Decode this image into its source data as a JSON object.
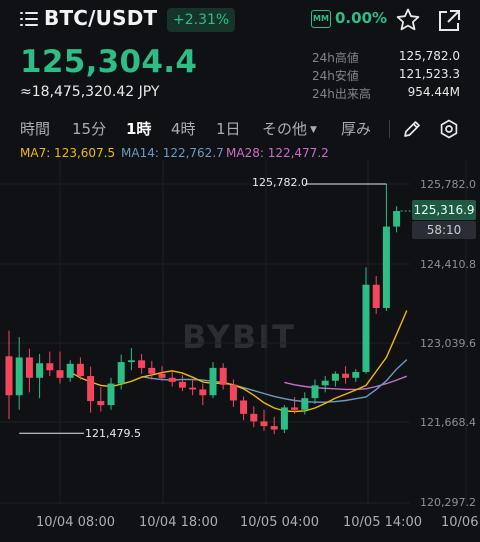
{
  "header": {
    "pair": "BTC/USDT",
    "change": "+2.31%",
    "mm_badge": "MM",
    "mm_value": "0.00%",
    "price": "125,304.4",
    "price_jpy": "≈18,475,320.42 JPY",
    "stats": [
      {
        "label": "24h高値",
        "value": "125,782.0"
      },
      {
        "label": "24h安値",
        "value": "121,523.3"
      },
      {
        "label": "24h出来高",
        "value": "954.44M"
      }
    ]
  },
  "tabs": [
    {
      "label": "時間",
      "active": false
    },
    {
      "label": "15分",
      "active": false
    },
    {
      "label": "1時",
      "active": true
    },
    {
      "label": "4時",
      "active": false
    },
    {
      "label": "1日",
      "active": false
    },
    {
      "label": "その他",
      "active": false
    },
    {
      "label": "厚み",
      "active": false
    }
  ],
  "icons": {
    "menu": "menu-icon",
    "star": "star-icon",
    "share": "share-icon",
    "edit": "pencil-icon",
    "settings": "gear-icon"
  },
  "colors": {
    "up": "#2ebd85",
    "down": "#f6465d",
    "ma7": "#f0b90b",
    "ma14": "#6b9ac4",
    "ma28": "#c86fc9"
  },
  "ma_legend": [
    {
      "label": "MA7: 123,607.5"
    },
    {
      "label": "MA14: 122,762.7"
    },
    {
      "label": "MA28: 122,477.2"
    }
  ],
  "chart_data": {
    "type": "candlestick",
    "y_ticks": [
      "125,782.0",
      "124,410.8",
      "123,039.6",
      "121,668.4",
      "120,297.2"
    ],
    "x_ticks": [
      "10/04 08:00",
      "10/04 18:00",
      "10/05 04:00",
      "10/05 14:00",
      "10/06"
    ],
    "ylim": [
      120297.2,
      125782.0
    ],
    "last_price": "125,316.9",
    "countdown": "58:10",
    "high_marker": "125,782.0",
    "low_marker": "121,479.5",
    "watermark": "BYBIT",
    "candles": [
      {
        "o": 122820,
        "h": 123260,
        "l": 121740,
        "c": 122150
      },
      {
        "o": 122150,
        "h": 123150,
        "l": 121900,
        "c": 122800
      },
      {
        "o": 122800,
        "h": 122950,
        "l": 122200,
        "c": 122450
      },
      {
        "o": 122450,
        "h": 122860,
        "l": 122100,
        "c": 122700
      },
      {
        "o": 122700,
        "h": 122900,
        "l": 122480,
        "c": 122580
      },
      {
        "o": 122580,
        "h": 122900,
        "l": 122350,
        "c": 122450
      },
      {
        "o": 122450,
        "h": 122750,
        "l": 122380,
        "c": 122690
      },
      {
        "o": 122690,
        "h": 122800,
        "l": 122420,
        "c": 122480
      },
      {
        "o": 122480,
        "h": 122640,
        "l": 121850,
        "c": 122050
      },
      {
        "o": 122050,
        "h": 122290,
        "l": 121870,
        "c": 121980
      },
      {
        "o": 121980,
        "h": 122450,
        "l": 121900,
        "c": 122350
      },
      {
        "o": 122350,
        "h": 122850,
        "l": 122250,
        "c": 122720
      },
      {
        "o": 122720,
        "h": 122960,
        "l": 122580,
        "c": 122750
      },
      {
        "o": 122750,
        "h": 122860,
        "l": 122520,
        "c": 122620
      },
      {
        "o": 122620,
        "h": 122740,
        "l": 122420,
        "c": 122520
      },
      {
        "o": 122520,
        "h": 122650,
        "l": 122400,
        "c": 122450
      },
      {
        "o": 122450,
        "h": 122560,
        "l": 122300,
        "c": 122380
      },
      {
        "o": 122380,
        "h": 122500,
        "l": 122220,
        "c": 122280
      },
      {
        "o": 122280,
        "h": 122420,
        "l": 122150,
        "c": 122250
      },
      {
        "o": 122250,
        "h": 122350,
        "l": 121980,
        "c": 122150
      },
      {
        "o": 122150,
        "h": 122720,
        "l": 122100,
        "c": 122620
      },
      {
        "o": 122620,
        "h": 122700,
        "l": 122250,
        "c": 122330
      },
      {
        "o": 122330,
        "h": 122420,
        "l": 121950,
        "c": 122060
      },
      {
        "o": 122060,
        "h": 122130,
        "l": 121720,
        "c": 121830
      },
      {
        "o": 121830,
        "h": 121960,
        "l": 121600,
        "c": 121700
      },
      {
        "o": 121700,
        "h": 121900,
        "l": 121540,
        "c": 121620
      },
      {
        "o": 121620,
        "h": 121780,
        "l": 121480,
        "c": 121560
      },
      {
        "o": 121560,
        "h": 121980,
        "l": 121500,
        "c": 121940
      },
      {
        "o": 121940,
        "h": 122120,
        "l": 121830,
        "c": 121900
      },
      {
        "o": 121900,
        "h": 122200,
        "l": 121820,
        "c": 122100
      },
      {
        "o": 122100,
        "h": 122420,
        "l": 122000,
        "c": 122320
      },
      {
        "o": 122320,
        "h": 122480,
        "l": 122200,
        "c": 122400
      },
      {
        "o": 122400,
        "h": 122560,
        "l": 122300,
        "c": 122520
      },
      {
        "o": 122520,
        "h": 122650,
        "l": 122350,
        "c": 122450
      },
      {
        "o": 122450,
        "h": 122600,
        "l": 122380,
        "c": 122550
      },
      {
        "o": 122550,
        "h": 124350,
        "l": 122520,
        "c": 124050
      },
      {
        "o": 124050,
        "h": 124200,
        "l": 123550,
        "c": 123650
      },
      {
        "o": 123650,
        "h": 125782,
        "l": 123600,
        "c": 125050
      },
      {
        "o": 125050,
        "h": 125400,
        "l": 124950,
        "c": 125316.9
      }
    ],
    "ma7": [
      null,
      null,
      null,
      null,
      null,
      null,
      122550,
      122450,
      122380,
      122320,
      122300,
      122340,
      122390,
      122460,
      122500,
      122540,
      122570,
      122530,
      122460,
      122380,
      122350,
      122360,
      122330,
      122260,
      122150,
      122020,
      121930,
      121880,
      121870,
      121880,
      121930,
      122010,
      122100,
      122170,
      122240,
      122320,
      122560,
      122800,
      123200,
      123607.5
    ],
    "ma14": [
      null,
      null,
      null,
      null,
      null,
      null,
      null,
      null,
      null,
      null,
      null,
      null,
      null,
      122470,
      122440,
      122420,
      122410,
      122420,
      122420,
      122410,
      122390,
      122370,
      122330,
      122280,
      122230,
      122180,
      122130,
      122090,
      122060,
      122040,
      122030,
      122030,
      122040,
      122060,
      122090,
      122120,
      122250,
      122400,
      122600,
      122762.7
    ],
    "ma28": [
      null,
      null,
      null,
      null,
      null,
      null,
      null,
      null,
      null,
      null,
      null,
      null,
      null,
      null,
      null,
      null,
      null,
      null,
      null,
      null,
      null,
      null,
      null,
      null,
      null,
      null,
      null,
      122370,
      122330,
      122300,
      122280,
      122270,
      122260,
      122250,
      122250,
      122260,
      122300,
      122350,
      122410,
      122477.2
    ]
  }
}
